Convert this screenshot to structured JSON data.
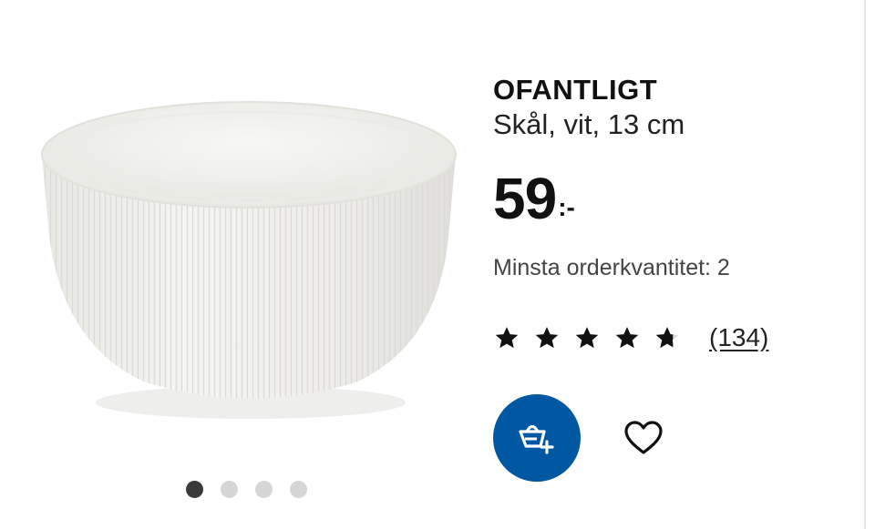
{
  "product": {
    "name": "OFANTLIGT",
    "description": "Skål, vit, 13 cm",
    "price_integer": "59",
    "price_decimal": ":-",
    "min_order": "Minsta orderkvantitet: 2",
    "rating": 4.5,
    "rating_max": 5,
    "review_count": "(134)"
  },
  "gallery": {
    "image_count": 4,
    "active_index": 0
  },
  "icons": {
    "add_to_cart": "add-to-cart-icon",
    "favourite": "heart-icon",
    "star": "star-icon"
  },
  "colors": {
    "primary_button": "#0058a3",
    "text": "#111111",
    "dot_active": "#3a3a3a",
    "dot_inactive": "#d6d6d6"
  }
}
